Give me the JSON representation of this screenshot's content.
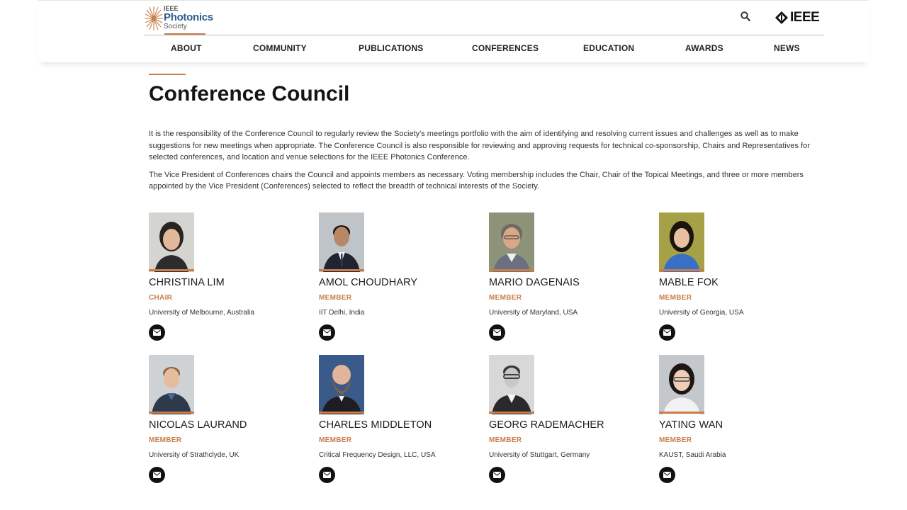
{
  "header": {
    "logo": {
      "line1": "IEEE",
      "line2": "Photonics",
      "line3": "Society"
    },
    "ieee_logo": "IEEE",
    "search_icon": "search-icon"
  },
  "nav": [
    {
      "label": "ABOUT",
      "active": true
    },
    {
      "label": "COMMUNITY"
    },
    {
      "label": "PUBLICATIONS"
    },
    {
      "label": "CONFERENCES"
    },
    {
      "label": "EDUCATION"
    },
    {
      "label": "AWARDS"
    },
    {
      "label": "NEWS"
    }
  ],
  "page": {
    "title": "Conference Council",
    "paragraphs": [
      "It is the responsibility of the Conference Council to regularly review the Society's meetings portfolio with the aim of identifying and resolving current issues and challenges as well as to make suggestions for new meetings when appropriate. The Conference Council is also responsible for reviewing and approving requests for technical co-sponsorship, Chairs and Representatives for selected conferences, and location and venue selections for the IEEE Photonics Conference.",
      "The Vice President of Conferences chairs the Council and appoints members as necessary. Voting membership includes the Chair, Chair of the Topical Meetings, and three or more members appointed by the Vice President (Conferences) selected to reflect the breadth of technical interests of the Society."
    ]
  },
  "members": [
    {
      "name": "CHRISTINA LIM",
      "role": "CHAIR",
      "affiliation": "University of Melbourne, Australia"
    },
    {
      "name": "AMOL CHOUDHARY",
      "role": "MEMBER",
      "affiliation": "IIT Delhi, India"
    },
    {
      "name": "MARIO DAGENAIS",
      "role": "MEMBER",
      "affiliation": "University of Maryland, USA"
    },
    {
      "name": "MABLE FOK",
      "role": "MEMBER",
      "affiliation": "University of Georgia, USA"
    },
    {
      "name": "NICOLAS LAURAND",
      "role": "MEMBER",
      "affiliation": "University of Strathclyde, UK"
    },
    {
      "name": "CHARLES MIDDLETON",
      "role": "MEMBER",
      "affiliation": "Critical Frequency Design, LLC, USA"
    },
    {
      "name": "GEORG RADEMACHER",
      "role": "MEMBER",
      "affiliation": "University of Stuttgart, Germany"
    },
    {
      "name": "YATING WAN",
      "role": "MEMBER",
      "affiliation": "KAUST, Saudi Arabia"
    }
  ],
  "colors": {
    "accent": "#c87d4a",
    "brand_blue": "#2d5d8f",
    "icon_bg": "#111111"
  }
}
